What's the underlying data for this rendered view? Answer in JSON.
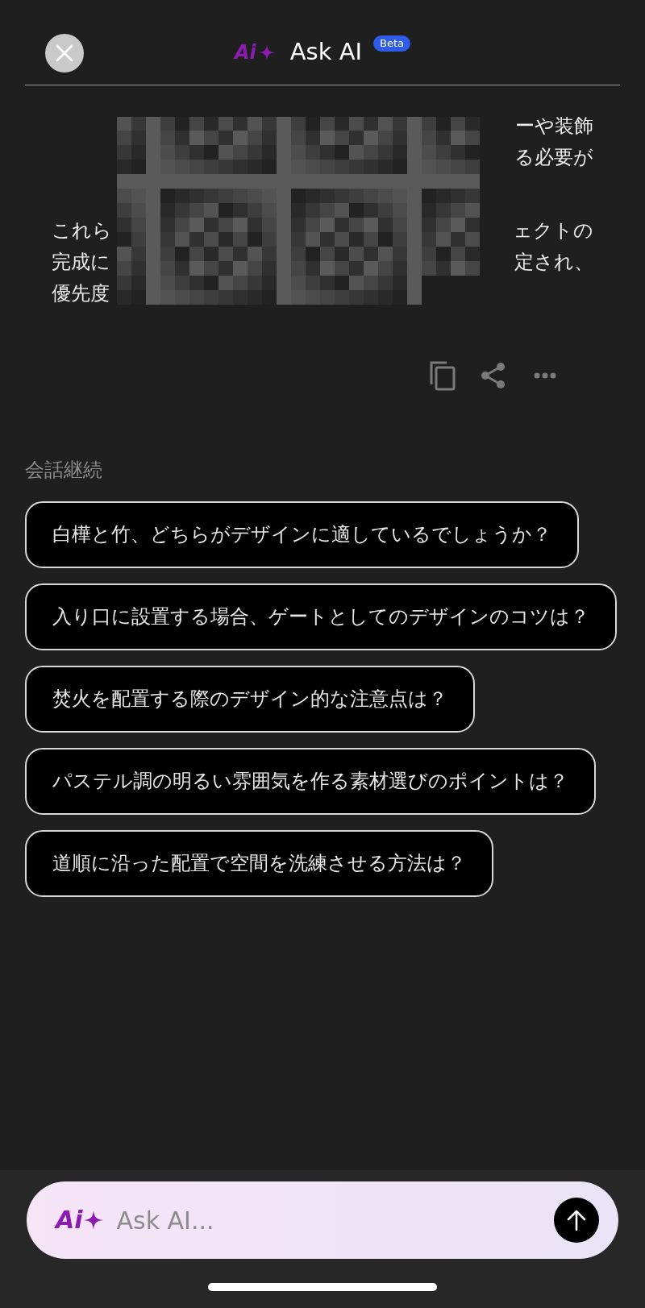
{
  "header": {
    "logo_text": "Ai",
    "title": "Ask AI",
    "badge": "Beta"
  },
  "answer": {
    "paragraphs": [
      {
        "lines": [
          {
            "right": "ーや装飾"
          },
          {
            "right": "る必要が"
          }
        ]
      },
      {
        "lines": [
          {
            "left": "これら",
            "right": "ェクトの"
          },
          {
            "left": "完成に",
            "right": "定され、"
          },
          {
            "left": "優先度"
          }
        ]
      }
    ]
  },
  "followup": {
    "label": "会話継続",
    "suggestions": [
      "白樺と竹、どちらがデザインに適しているでしょうか？",
      "入り口に設置する場合、ゲートとしてのデザインのコツは？",
      "焚火を配置する際のデザイン的な注意点は？",
      "パステル調の明るい雰囲気を作る素材選びのポイントは？",
      "道順に沿った配置で空間を洗練させる方法は？"
    ]
  },
  "input": {
    "logo_text": "Ai",
    "placeholder": "Ask AI..."
  }
}
